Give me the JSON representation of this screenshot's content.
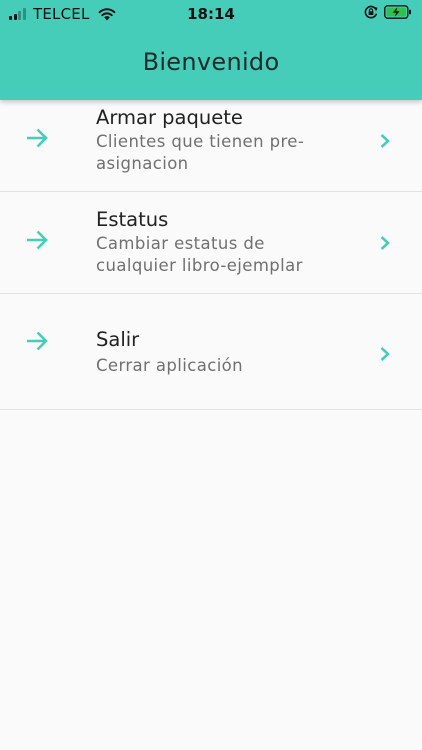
{
  "status_bar": {
    "carrier": "TELCEL",
    "time": "18:14",
    "icons": [
      "signal-icon",
      "wifi-icon",
      "rotation-lock-icon",
      "battery-charging-icon"
    ]
  },
  "app_bar": {
    "title": "Bienvenido",
    "color": "#45cdb9"
  },
  "menu": {
    "items": [
      {
        "label": "Armar paquete",
        "description": "Clientes que tienen pre-asignacion",
        "icon": "arrow-right-icon",
        "trailing_icon": "chevron-right-icon"
      },
      {
        "label": "Estatus",
        "description": "Cambiar estatus de cualquier libro-ejemplar",
        "icon": "arrow-right-icon",
        "trailing_icon": "chevron-right-icon"
      },
      {
        "label": "Salir",
        "description": "Cerrar aplicación",
        "icon": "arrow-right-icon",
        "trailing_icon": "chevron-right-icon"
      }
    ]
  }
}
